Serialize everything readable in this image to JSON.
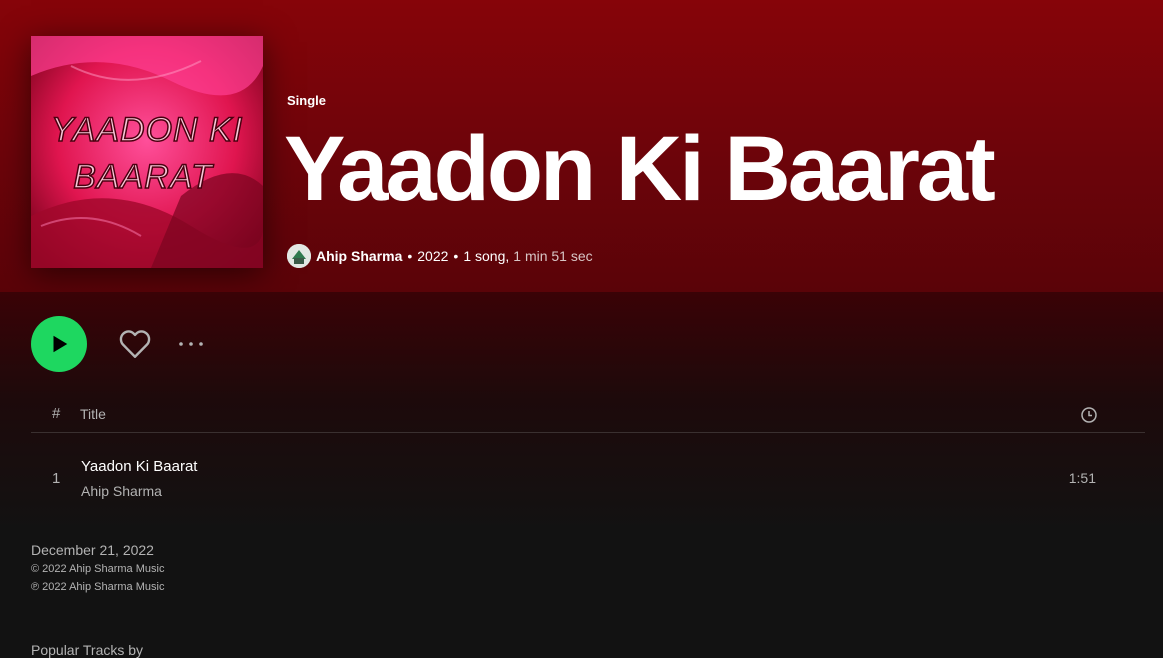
{
  "header": {
    "type_label": "Single",
    "title": "Yaadon Ki Baarat",
    "artist": "Ahip Sharma",
    "year": "2022",
    "song_count": "1 song,",
    "duration": "1 min 51 sec",
    "separator": "•"
  },
  "cover": {
    "text_line1": "YAADON KI",
    "text_line2": "BAARAT"
  },
  "controls": {
    "play_icon": "play-icon",
    "like_icon": "heart-icon",
    "more_icon": "more-icon"
  },
  "tracklist": {
    "header_number": "#",
    "header_title": "Title",
    "header_duration_icon": "clock-icon",
    "tracks": [
      {
        "number": "1",
        "title": "Yaadon Ki Baarat",
        "artist": "Ahip Sharma",
        "duration": "1:51"
      }
    ]
  },
  "footer": {
    "release_date": "December 21, 2022",
    "copyright": "© 2022 Ahip Sharma Music",
    "phonogram": "℗ 2022 Ahip Sharma Music",
    "popular_tracks": "Popular Tracks by"
  },
  "colors": {
    "accent": "#1ed760",
    "hero": "#860409",
    "background": "#121212"
  }
}
